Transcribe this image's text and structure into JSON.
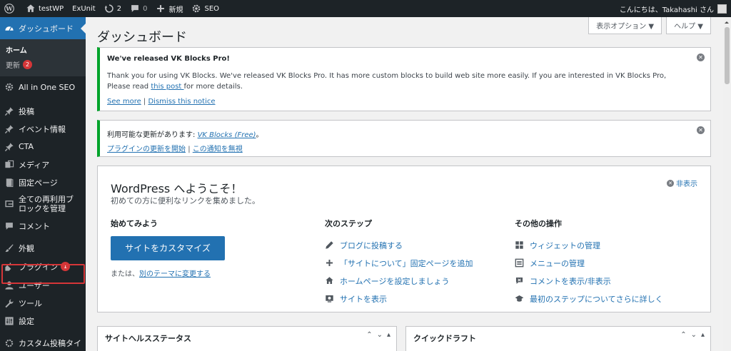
{
  "adminbar": {
    "site_name": "testWP",
    "exunit": "ExUnit",
    "updates_count": "2",
    "comments_count": "0",
    "new_label": "新規",
    "seo_label": "SEO",
    "greeting": "こんにちは、Takahashi さん"
  },
  "sidebar": {
    "dashboard": "ダッシュボード",
    "home": "ホーム",
    "updates": "更新",
    "updates_badge": "2",
    "aioseo": "All in One SEO",
    "posts": "投稿",
    "events": "イベント情報",
    "cta": "CTA",
    "media": "メディア",
    "pages": "固定ページ",
    "reusable": "全ての再利用ブロックを管理",
    "comments": "コメント",
    "appearance": "外観",
    "plugins": "プラグイン",
    "plugins_badge": "1",
    "users": "ユーザー",
    "tools": "ツール",
    "settings": "設定",
    "custom_post": "カスタム投稿タイ"
  },
  "screen_meta": {
    "options": "表示オプション ▼",
    "help": "ヘルプ ▼"
  },
  "page_title": "ダッシュボード",
  "notice_vk": {
    "title": "We've released VK Blocks Pro!",
    "body_pre": "Thank you for using VK Blocks. We've released VK Blocks Pro. It has more custom blocks to build web site more easily. If you are interested in VK Blocks Pro, Please read ",
    "body_link": "this post ",
    "body_post": "for more details.",
    "see_more": "See more",
    "separator": "|",
    "dismiss": "Dismiss this notice"
  },
  "notice_update": {
    "text": "利用可能な更新があります: ",
    "plugin": "VK Blocks (Free)",
    "text_end": "。",
    "start_update": "プラグインの更新を開始",
    "separator": "|",
    "ignore": "この通知を無視"
  },
  "welcome": {
    "title": "WordPress へようこそ！",
    "about": "初めての方に便利なリンクを集めました。",
    "hide": "非表示",
    "col1_title": "始めてみよう",
    "customize": "サイトをカスタマイズ",
    "or_prefix": "または、",
    "change_theme": "別のテーマに変更する",
    "col2_title": "次のステップ",
    "next_steps": [
      "ブログに投稿する",
      "「サイトについて」固定ページを追加",
      "ホームページを設定しましょう",
      "サイトを表示"
    ],
    "col3_title": "その他の操作",
    "more_actions": [
      "ウィジェットの管理",
      "メニューの管理",
      "コメントを表示/非表示",
      "最初のステップについてさらに詳しく"
    ]
  },
  "postboxes": {
    "site_health": "サイトヘルスステータス",
    "quick_draft": "クイックドラフト"
  },
  "colors": {
    "admin_dark": "#1d2327",
    "accent": "#2271b1",
    "notice_success": "#00a32a",
    "badge": "#d63638"
  }
}
